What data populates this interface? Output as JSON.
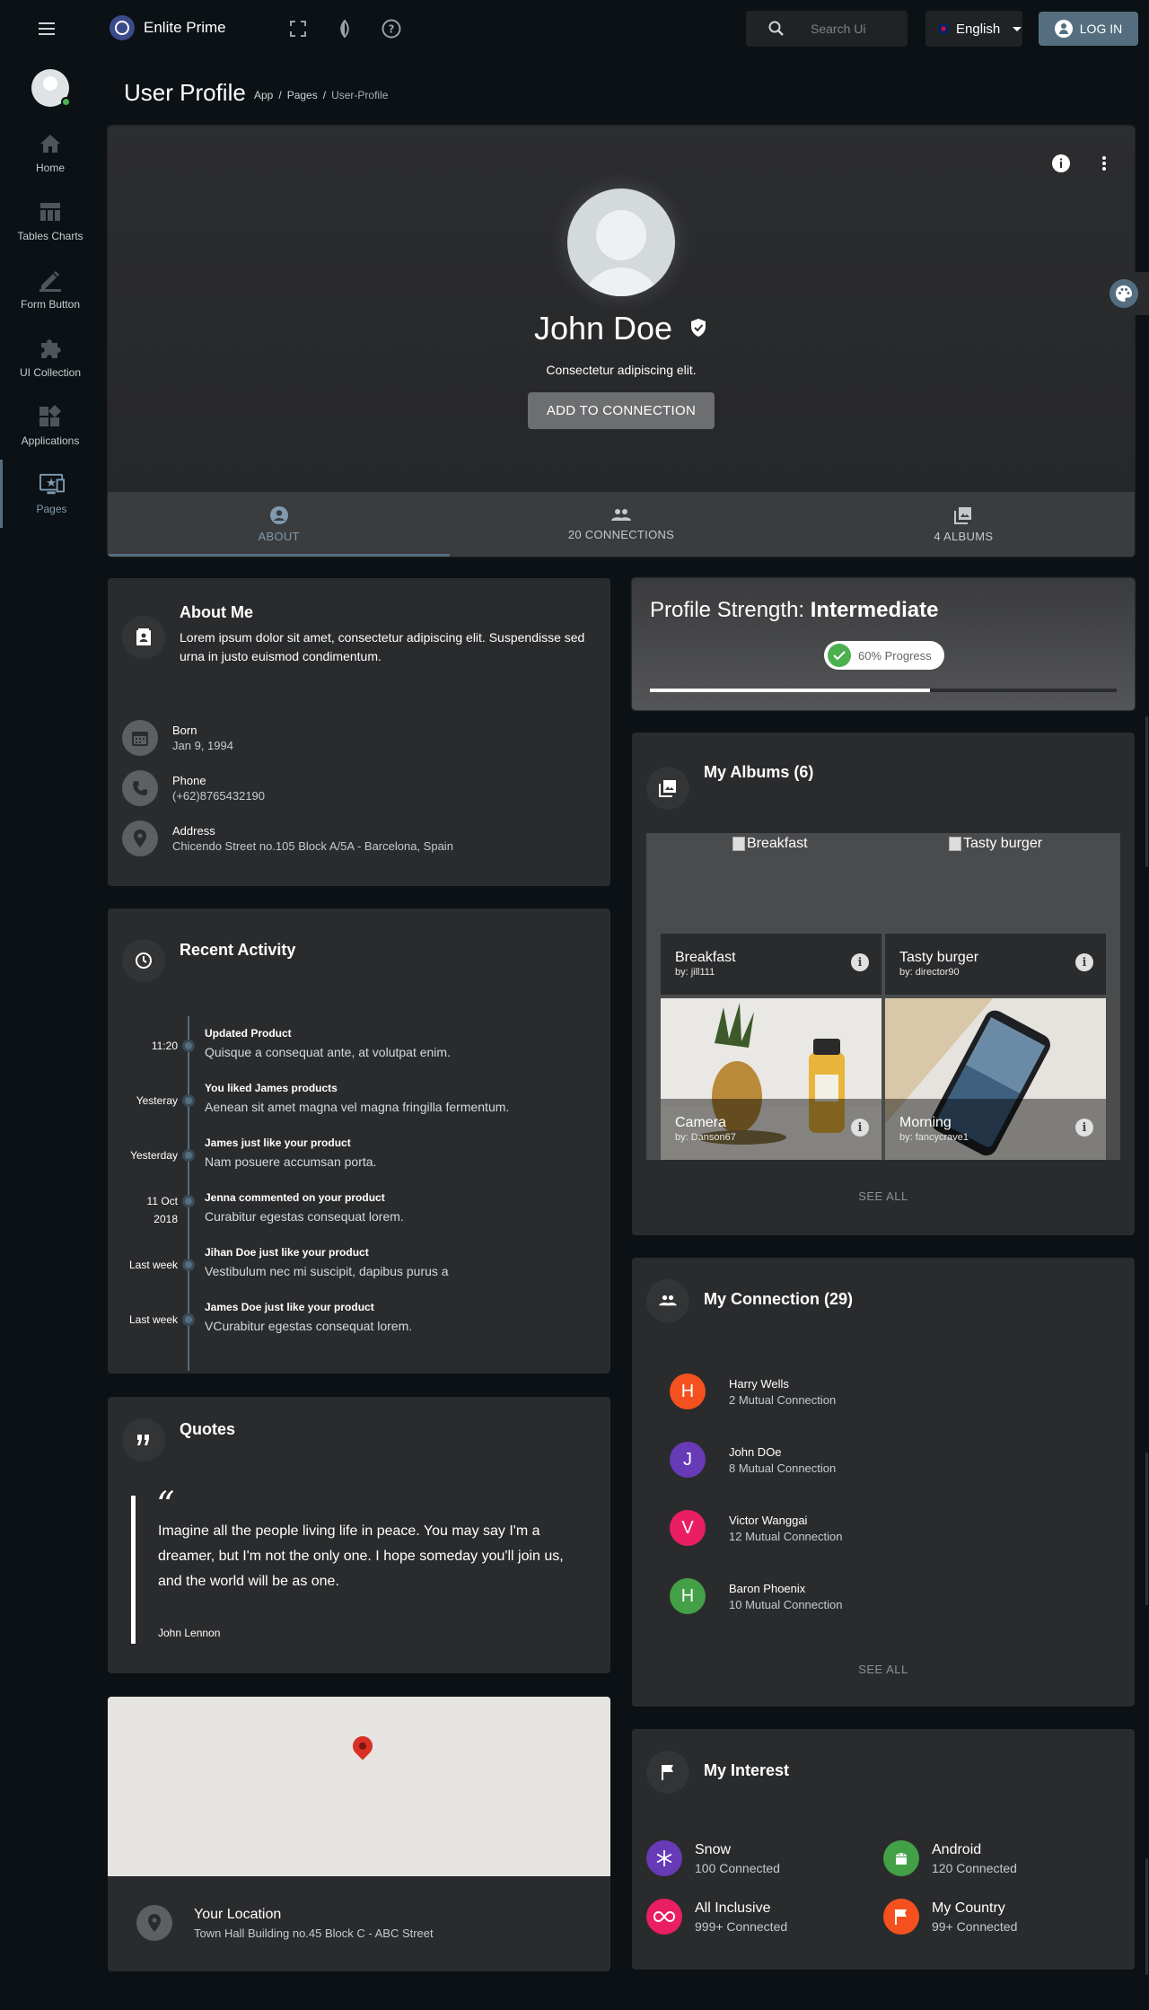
{
  "app": {
    "brand": "Enlite Prime"
  },
  "topbar": {
    "search_placeholder": "Search Ui",
    "language": "English",
    "login_label": "LOG IN"
  },
  "sidebar": {
    "items": [
      {
        "label": "Home",
        "icon": "home-icon"
      },
      {
        "label": "Tables Charts",
        "icon": "table-icon"
      },
      {
        "label": "Form Button",
        "icon": "pencil-icon"
      },
      {
        "label": "UI Collection",
        "icon": "puzzle-icon"
      },
      {
        "label": "Applications",
        "icon": "widgets-icon"
      },
      {
        "label": "Pages",
        "icon": "monitor-star-icon",
        "active": true
      }
    ]
  },
  "page": {
    "title": "User Profile",
    "breadcrumb": [
      "App",
      "Pages",
      "User-Profile"
    ]
  },
  "profile": {
    "name": "John Doe",
    "description": "Consectetur adipiscing elit.",
    "add_button": "ADD TO CONNECTION",
    "tabs": [
      {
        "label": "ABOUT",
        "icon": "account-circle-icon",
        "active": true
      },
      {
        "label": "20 CONNECTIONS",
        "icon": "people-icon"
      },
      {
        "label": "4 ALBUMS",
        "icon": "photo-library-icon"
      }
    ]
  },
  "about": {
    "title": "About Me",
    "text": "Lorem ipsum dolor sit amet, consectetur adipiscing elit. Suspendisse sed urna in justo euismod condimentum.",
    "born_label": "Born",
    "born_value": "Jan 9, 1994",
    "phone_label": "Phone",
    "phone_value": "(+62)8765432190",
    "address_label": "Address",
    "address_value": "Chicendo Street no.105 Block A/5A - Barcelona, Spain"
  },
  "strength": {
    "title_prefix": "Profile Strength:",
    "title_level": "Intermediate",
    "progress_label": "60% Progress",
    "progress": 0.6
  },
  "albums": {
    "title": "My Albums (6)",
    "items": [
      {
        "alt": "Breakfast",
        "name": "Breakfast",
        "by": "by: jill111"
      },
      {
        "alt": "Tasty burger",
        "name": "Tasty burger",
        "by": "by: director90"
      },
      {
        "name": "Camera",
        "by": "by: Danson67"
      },
      {
        "name": "Morning",
        "by": "by: fancycrave1"
      }
    ],
    "see_all": "SEE ALL"
  },
  "activity": {
    "title": "Recent Activity",
    "items": [
      {
        "time": "11:20",
        "title": "Updated Product",
        "desc": "Quisque a consequat ante, at volutpat enim."
      },
      {
        "time": "Yesteray",
        "title": "You liked James products",
        "desc": "Aenean sit amet magna vel magna fringilla fermentum."
      },
      {
        "time": "Yesterday",
        "title": "James just like your product",
        "desc": "Nam posuere accumsan porta."
      },
      {
        "time": "11 Oct 2018",
        "title": "Jenna commented on your product",
        "desc": "Curabitur egestas consequat lorem."
      },
      {
        "time": "Last week",
        "title": "Jihan Doe just like your product",
        "desc": "Vestibulum nec mi suscipit, dapibus purus a"
      },
      {
        "time": "Last week",
        "title": "James Doe just like your product",
        "desc": "VCurabitur egestas consequat lorem."
      }
    ]
  },
  "quotes": {
    "title": "Quotes",
    "mark": "“",
    "text": "Imagine all the people living life in peace. You may say I'm a dreamer, but I'm not the only one. I hope someday you'll join us, and the world will be as one.",
    "author": "John Lennon"
  },
  "location": {
    "title": "Your Location",
    "address": "Town Hall Building no.45 Block C - ABC Street"
  },
  "connections": {
    "title": "My Connection (29)",
    "items": [
      {
        "initial": "H",
        "name": "Harry Wells",
        "sub": "2 Mutual Connection",
        "color": "#f4511e"
      },
      {
        "initial": "J",
        "name": "John DOe",
        "sub": "8 Mutual Connection",
        "color": "#673ab7"
      },
      {
        "initial": "V",
        "name": "Victor Wanggai",
        "sub": "12 Mutual Connection",
        "color": "#e91e63"
      },
      {
        "initial": "H",
        "name": "Baron Phoenix",
        "sub": "10 Mutual Connection",
        "color": "#43a047"
      }
    ],
    "see_all": "SEE ALL"
  },
  "interest": {
    "title": "My Interest",
    "items": [
      {
        "name": "Snow",
        "sub": "100 Connected",
        "color": "#673ab7",
        "icon": "snowflake-icon"
      },
      {
        "name": "Android",
        "sub": "120 Connected",
        "color": "#43a047",
        "icon": "android-icon"
      },
      {
        "name": "All Inclusive",
        "sub": "999+ Connected",
        "color": "#e91e63",
        "icon": "infinity-icon"
      },
      {
        "name": "My Country",
        "sub": "99+ Connected",
        "color": "#f4511e",
        "icon": "flag-icon"
      }
    ]
  }
}
